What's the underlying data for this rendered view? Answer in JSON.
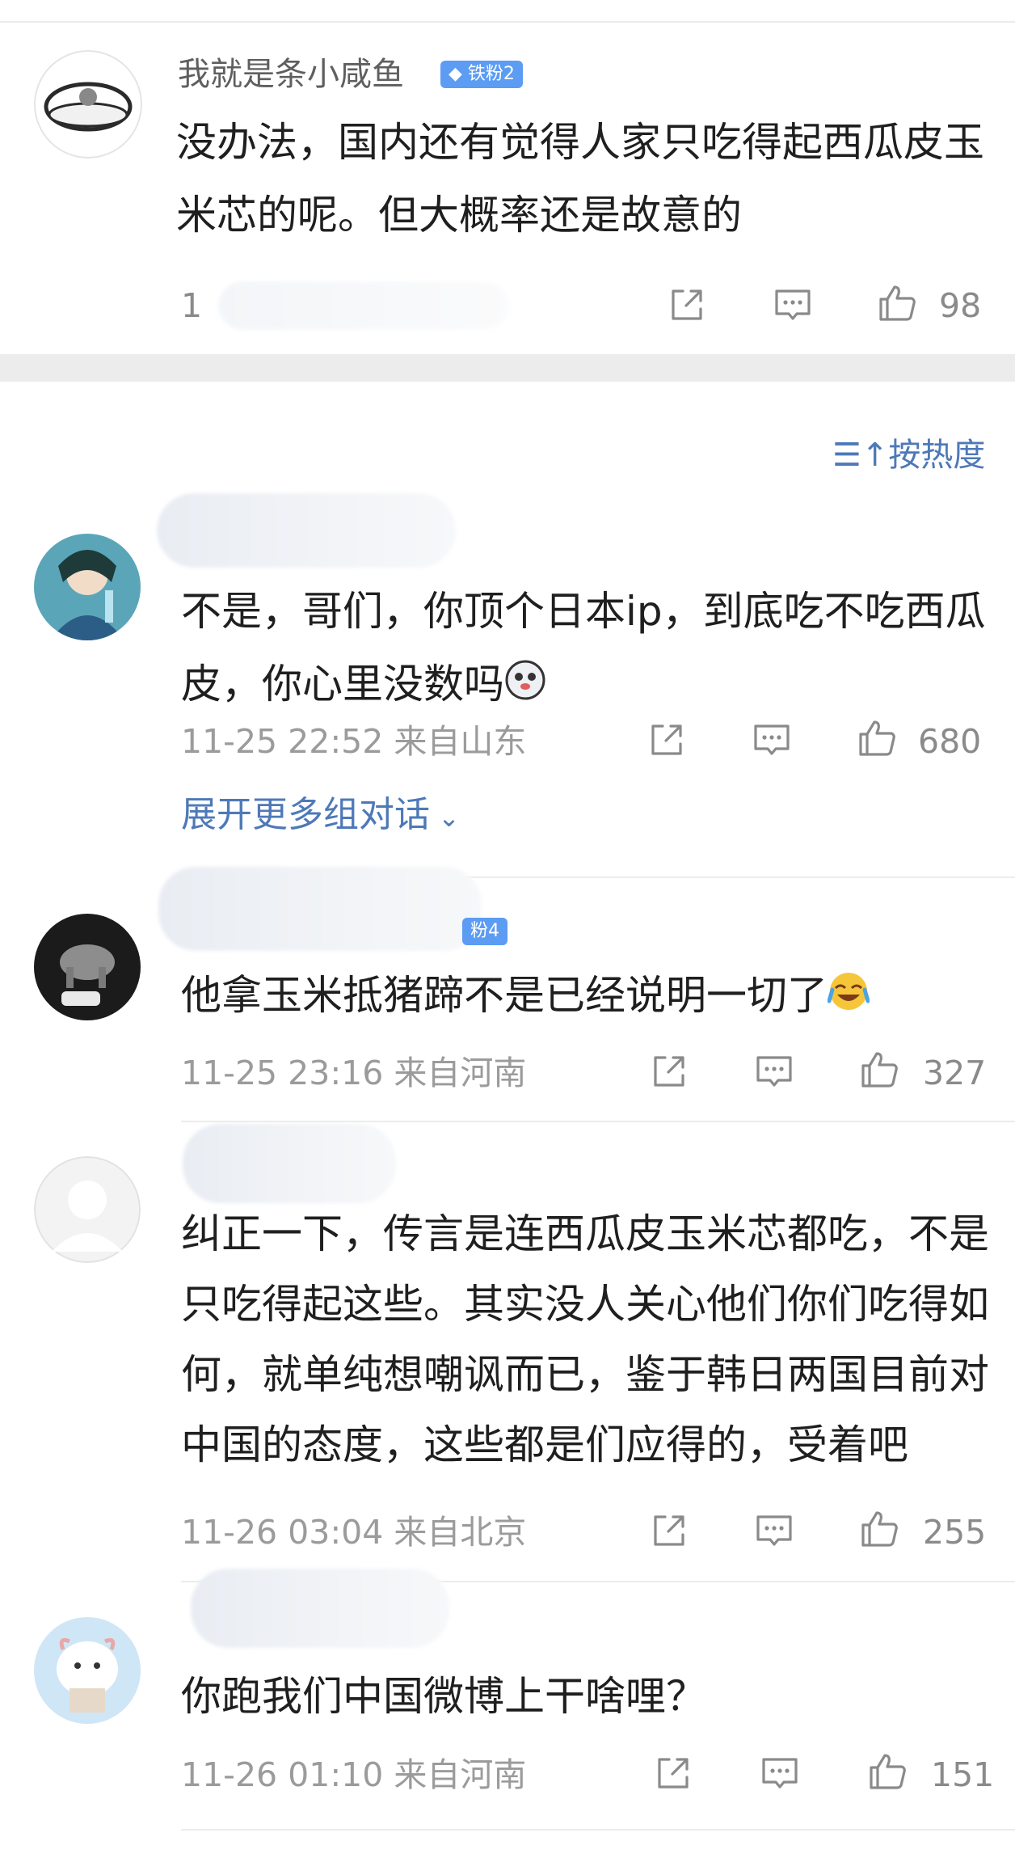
{
  "sort": {
    "label": "按热度"
  },
  "pinned": {
    "username": "我就是条小咸鱼",
    "badge": "铁粉2",
    "text": "没办法，国内还有觉得人家只吃得起西瓜皮玉米芯的呢。但大概率还是故意的",
    "reply_count": "1",
    "likes": "98"
  },
  "comments": [
    {
      "text": "不是，哥们，你顶个日本ip，到底吃不吃西瓜皮，你心里没数吗",
      "time": "11-25 22:52",
      "location": "来自山东",
      "likes": "680",
      "more_label": "展开更多组对话"
    },
    {
      "badge": "粉4",
      "text": "他拿玉米抵猪蹄不是已经说明一切了",
      "time": "11-25 23:16",
      "location": "来自河南",
      "likes": "327"
    },
    {
      "text": "纠正一下，传言是连西瓜皮玉米芯都吃，不是只吃得起这些。其实没人关心他们你们吃得如何，就单纯想嘲讽而已，鉴于韩日两国目前对中国的态度，这些都是们应得的，受着吧",
      "time": "11-26 03:04",
      "location": "来自北京",
      "likes": "255"
    },
    {
      "text": "你跑我们中国微博上干啥哩？",
      "time": "11-26 01:10",
      "location": "来自河南",
      "likes": "151"
    }
  ],
  "colors": {
    "link": "#4e79b8",
    "badge": "#5c9cf3",
    "meta": "#9b9b9b"
  }
}
